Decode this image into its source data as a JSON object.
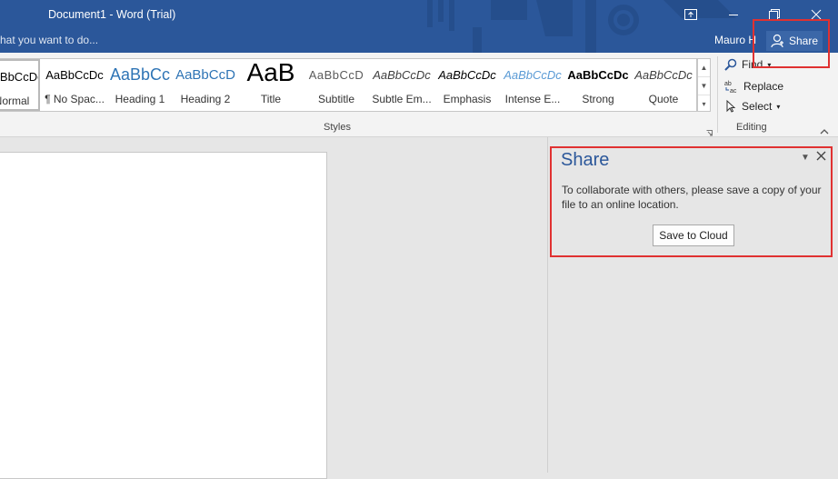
{
  "title_bar": {
    "document_title": "Document1 - Word (Trial)",
    "tell_me_text": "hat you want to do...",
    "user_name": "Mauro H",
    "share_label": "Share",
    "accent_color": "#2b579a"
  },
  "ribbon": {
    "styles": [
      {
        "sample": "AaBbCcDc",
        "label": "Normal"
      },
      {
        "sample": "AaBbCcDc",
        "label": "¶ No Spac..."
      },
      {
        "sample": "AaBbCc",
        "label": "Heading 1"
      },
      {
        "sample": "AaBbCcD",
        "label": "Heading 2"
      },
      {
        "sample": "AaB",
        "label": "Title"
      },
      {
        "sample": "AaBbCcD",
        "label": "Subtitle"
      },
      {
        "sample": "AaBbCcDc",
        "label": "Subtle Em..."
      },
      {
        "sample": "AaBbCcDc",
        "label": "Emphasis"
      },
      {
        "sample": "AaBbCcDc",
        "label": "Intense E..."
      },
      {
        "sample": "AaBbCcDc",
        "label": "Strong"
      },
      {
        "sample": "AaBbCcDc",
        "label": "Quote"
      }
    ],
    "styles_group_label": "Styles",
    "editing": {
      "find_label": "Find",
      "replace_label": "Replace",
      "select_label": "Select",
      "group_label": "Editing"
    }
  },
  "share_pane": {
    "title": "Share",
    "message": "To collaborate with others, please save a copy of your file to an online location.",
    "save_button_label": "Save to Cloud"
  }
}
